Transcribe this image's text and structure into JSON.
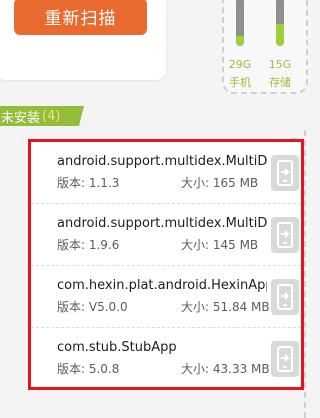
{
  "toolbar": {
    "rescan_label": "重新扫描"
  },
  "storage": {
    "phone": {
      "size": "29G",
      "name": "手机",
      "fill_percent": 20
    },
    "card": {
      "size": "15G",
      "name": "存储",
      "fill_percent": 45
    },
    "gauge_fill_color": "#9fcf3a",
    "gauge_track_color": "#8f8f8f"
  },
  "section": {
    "title": "未安装",
    "count": "(4)",
    "tag_color": "#93be3b"
  },
  "apps": [
    {
      "name": "android.support.multidex.MultiDe",
      "version": "版本: 1.1.3",
      "size": "大小: 165 MB",
      "icon": "install-phone-icon"
    },
    {
      "name": "android.support.multidex.MultiDe",
      "version": "版本: 1.9.6",
      "size": "大小: 145 MB",
      "icon": "install-phone-icon"
    },
    {
      "name": "com.hexin.plat.android.HexinAppli",
      "version": "版本: V5.0.0",
      "size": "大小: 51.84 MB",
      "icon": "install-phone-icon"
    },
    {
      "name": "com.stub.StubApp",
      "version": "版本: 5.0.8",
      "size": "大小: 43.33 MB",
      "icon": "install-phone-icon"
    }
  ],
  "highlight_color": "#e5141d",
  "accent_color": "#e96a2e"
}
